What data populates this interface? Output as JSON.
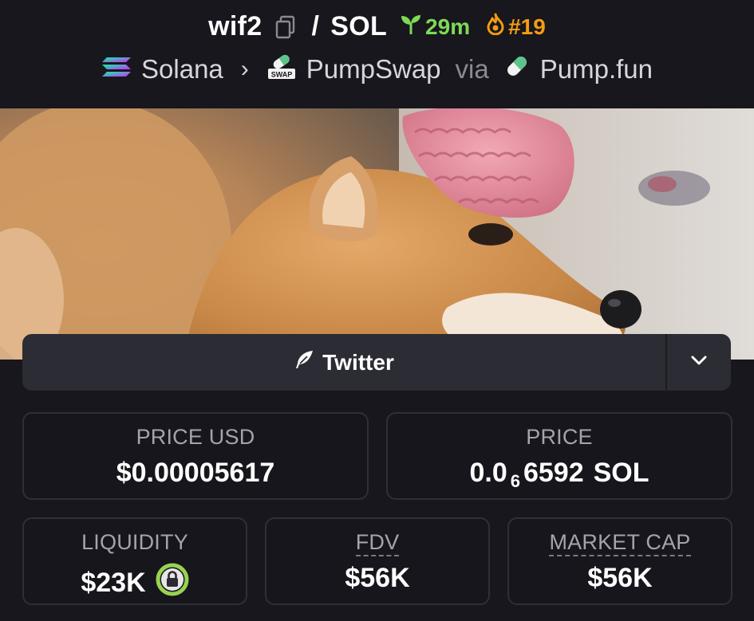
{
  "header": {
    "base_token": "wif2",
    "separator": "/",
    "quote_token": "SOL",
    "age": "29m",
    "rank": "#19",
    "chain": "Solana",
    "dex": "PumpSwap",
    "dex_badge": "SWAP",
    "via_label": "via",
    "launchpad": "Pump.fun"
  },
  "social": {
    "twitter_label": "Twitter"
  },
  "stats": {
    "price_usd_label": "PRICE USD",
    "price_usd_value": "$0.00005617",
    "price_label": "PRICE",
    "price_prefix": "0.0",
    "price_zero_count": "6",
    "price_digits": "6592",
    "price_quote": "SOL",
    "liquidity_label": "LIQUIDITY",
    "liquidity_value": "$23K",
    "fdv_label": "FDV",
    "fdv_value": "$56K",
    "market_cap_label": "MARKET CAP",
    "market_cap_value": "$56K"
  },
  "colors": {
    "background": "#17171d",
    "age_green": "#7ed957",
    "rank_orange": "#f39c12",
    "lock_green": "#9ad24f"
  }
}
